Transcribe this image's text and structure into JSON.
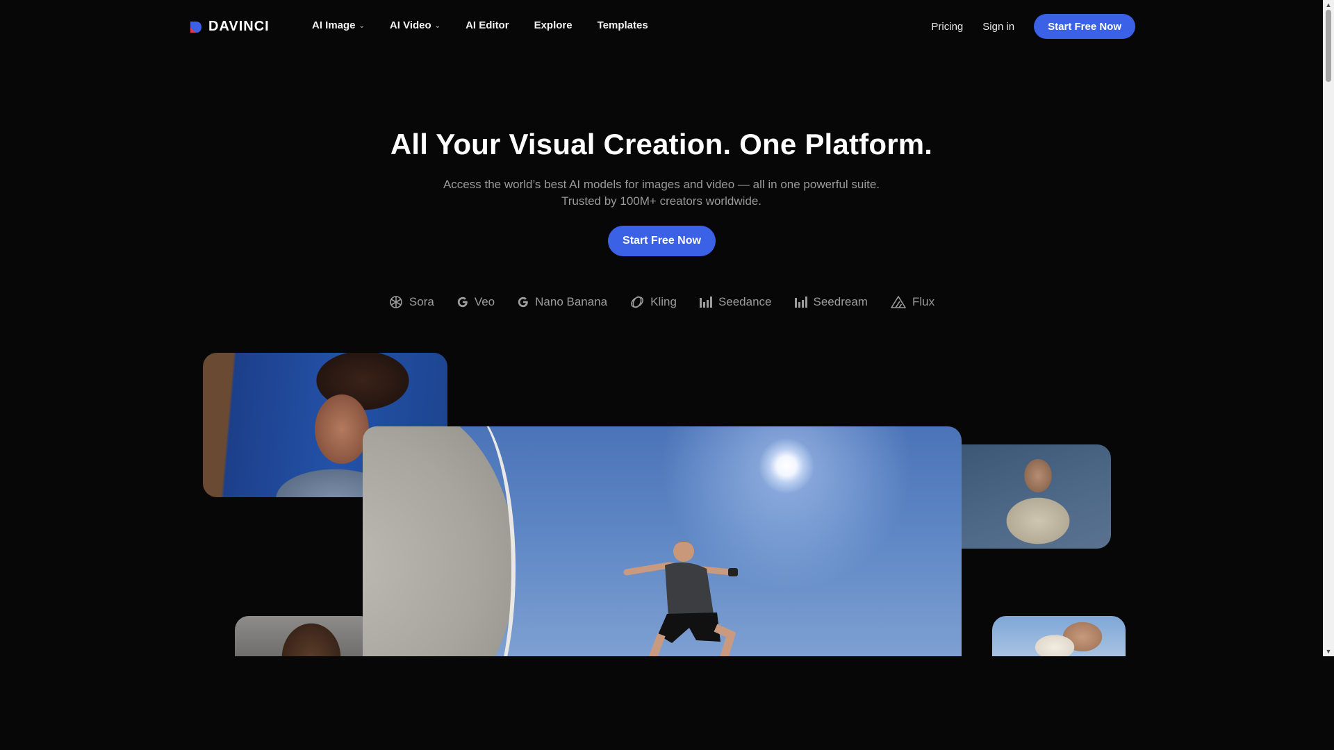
{
  "brand": {
    "name": "DAVINCI",
    "accent": "#3b61e6"
  },
  "nav": {
    "items": [
      {
        "label": "AI Image",
        "has_dropdown": true
      },
      {
        "label": "AI Video",
        "has_dropdown": true
      },
      {
        "label": "AI Editor",
        "has_dropdown": false
      },
      {
        "label": "Explore",
        "has_dropdown": false
      },
      {
        "label": "Templates",
        "has_dropdown": false
      }
    ],
    "pricing": "Pricing",
    "sign_in": "Sign in",
    "cta": "Start Free Now"
  },
  "hero": {
    "title": "All Your Visual Creation. One Platform.",
    "subtitle_line1": "Access the world’s best AI models for images and video — all in one powerful suite.",
    "subtitle_line2": "Trusted by 100M+ creators worldwide.",
    "cta": "Start Free Now"
  },
  "models": [
    {
      "name": "Sora",
      "icon": "openai-icon"
    },
    {
      "name": "Veo",
      "icon": "google-icon"
    },
    {
      "name": "Nano Banana",
      "icon": "google-icon"
    },
    {
      "name": "Kling",
      "icon": "kling-icon"
    },
    {
      "name": "Seedance",
      "icon": "bar-chart-icon"
    },
    {
      "name": "Seedream",
      "icon": "bar-chart-icon"
    },
    {
      "name": "Flux",
      "icon": "triangle-icon"
    }
  ]
}
